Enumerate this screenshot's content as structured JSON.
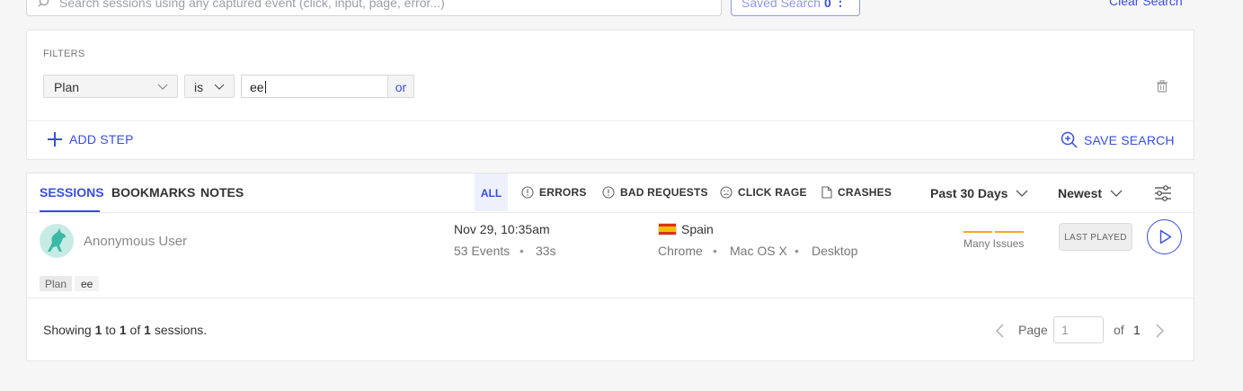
{
  "search": {
    "placeholder": "Search sessions using any captured event (click, input, page, error...)",
    "saved_search_label": "Saved Search",
    "saved_search_count": "0",
    "clear_label": "Clear Search"
  },
  "filters": {
    "section_label": "FILTERS",
    "field": "Plan",
    "operator": "is",
    "value": "ee",
    "or_label": "or",
    "add_step_label": "ADD STEP",
    "save_search_label": "SAVE SEARCH"
  },
  "tabs": [
    {
      "label": "SESSIONS",
      "active": true
    },
    {
      "label": "BOOKMARKS",
      "active": false
    },
    {
      "label": "NOTES",
      "active": false
    }
  ],
  "event_filters": {
    "all": "ALL",
    "errors": "ERRORS",
    "bad_requests": "BAD REQUESTS",
    "click_rage": "CLICK RAGE",
    "crashes": "CRASHES"
  },
  "period": "Past 30 Days",
  "sort": "Newest",
  "session": {
    "user": "Anonymous User",
    "date": "Nov 29, 10:35am",
    "events": "53 Events",
    "duration": "33s",
    "country": "Spain",
    "browser": "Chrome",
    "os": "Mac OS X",
    "device": "Desktop",
    "issues_label": "Many Issues",
    "last_played": "LAST PLAYED",
    "tag_key": "Plan",
    "tag_value": "ee"
  },
  "footer": {
    "showing_prefix": "Showing",
    "from": "1",
    "to_word": "to",
    "to": "1",
    "of_word": "of",
    "total": "1",
    "suffix": "sessions.",
    "page_label": "Page",
    "page_value": "1",
    "of_label": "of",
    "total_pages": "1"
  },
  "colors": {
    "accent": "#394ee0",
    "issues": "#f5a623",
    "avatar_bg": "#c6ebe4"
  }
}
